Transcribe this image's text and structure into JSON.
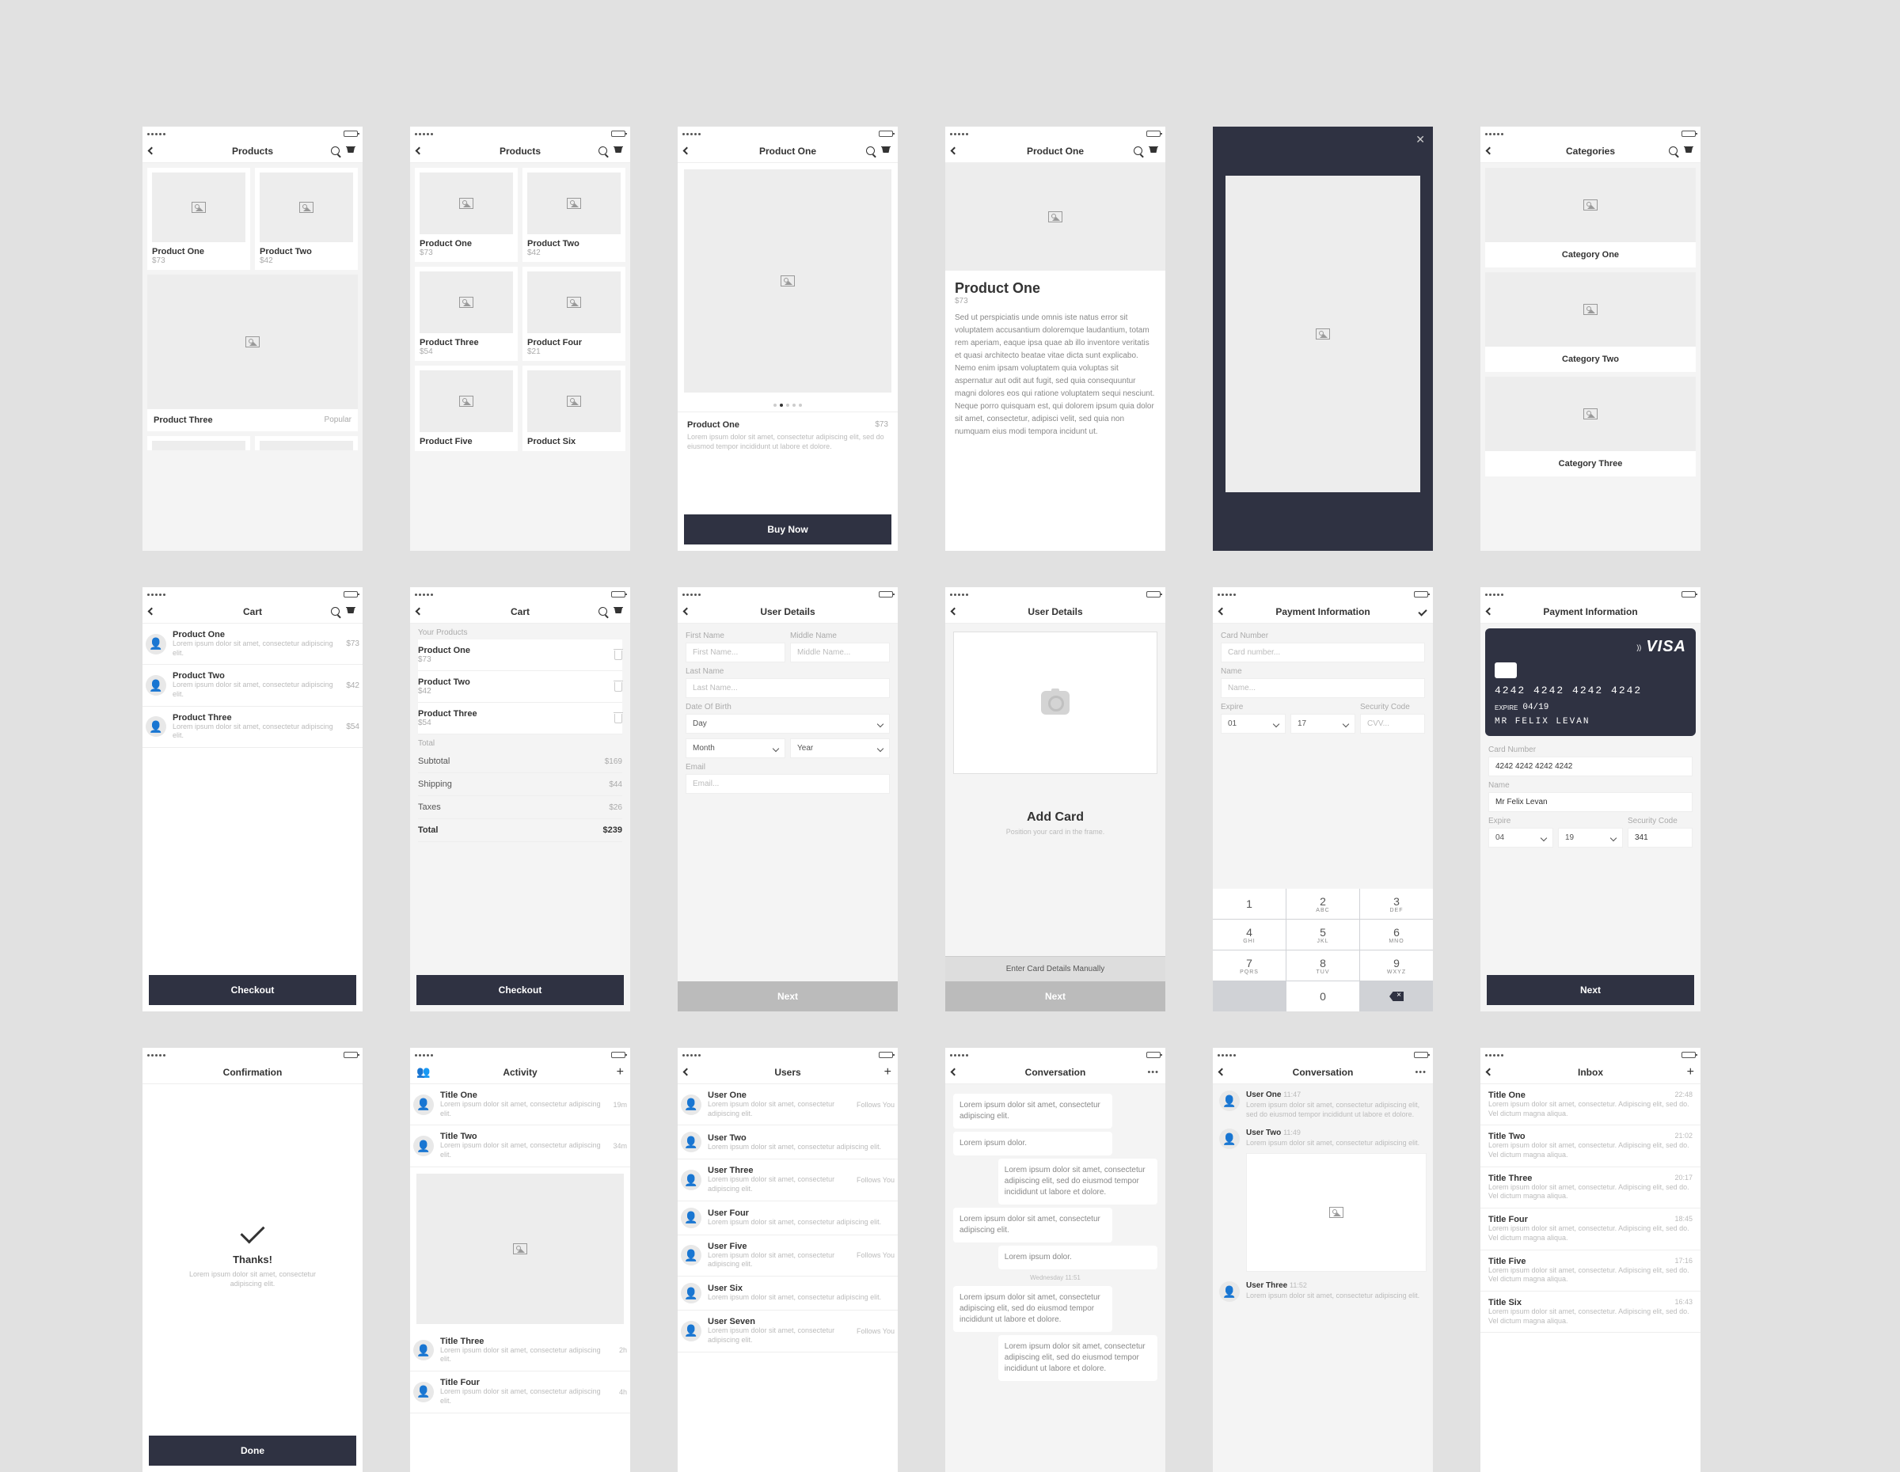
{
  "lorem_short": "Lorem ipsum dolor sit amet, consectetur adipiscing elit.",
  "lorem_med": "Lorem ipsum dolor sit amet, consectetur adipiscing elit, sed do eiusmod tempor incididunt ut labore et dolore.",
  "lorem_inbox": "Lorem ipsum dolor sit amet, consectetur. Adipiscing elit, sed do. Vel dictum magna aliqua.",
  "s1": {
    "title": "Products",
    "p1": {
      "name": "Product One",
      "price": "$73"
    },
    "p2": {
      "name": "Product Two",
      "price": "$42"
    },
    "p3": {
      "name": "Product Three"
    },
    "popular": "Popular"
  },
  "s2": {
    "title": "Products",
    "p1": {
      "name": "Product One",
      "price": "$73"
    },
    "p2": {
      "name": "Product Two",
      "price": "$42"
    },
    "p3": {
      "name": "Product Three",
      "price": "$54"
    },
    "p4": {
      "name": "Product Four",
      "price": "$21"
    },
    "p5": {
      "name": "Product Five"
    },
    "p6": {
      "name": "Product Six"
    }
  },
  "s3": {
    "title": "Product One",
    "name": "Product One",
    "price": "$73",
    "buy": "Buy Now"
  },
  "s4": {
    "title": "Product One",
    "name": "Product One",
    "price": "$73",
    "desc": "Sed ut perspiciatis unde omnis iste natus error sit voluptatem accusantium doloremque laudantium, totam rem aperiam, eaque ipsa quae ab illo inventore veritatis et quasi architecto beatae vitae dicta sunt explicabo. Nemo enim ipsam voluptatem quia voluptas sit aspernatur aut odit aut fugit, sed quia consequuntur magni dolores eos qui ratione voluptatem sequi nesciunt. Neque porro quisquam est, qui dolorem ipsum quia dolor sit amet, consectetur, adipisci velit, sed quia non numquam eius modi tempora incidunt ut."
  },
  "s6": {
    "title": "Categories",
    "c1": "Category One",
    "c2": "Category Two",
    "c3": "Category Three"
  },
  "s7": {
    "title": "Cart",
    "items": [
      {
        "name": "Product One",
        "price": "$73"
      },
      {
        "name": "Product Two",
        "price": "$42"
      },
      {
        "name": "Product Three",
        "price": "$54"
      }
    ],
    "checkout": "Checkout"
  },
  "s8": {
    "title": "Cart",
    "your": "Your Products",
    "items": [
      {
        "name": "Product One",
        "price": "$73"
      },
      {
        "name": "Product Two",
        "price": "$42"
      },
      {
        "name": "Product Three",
        "price": "$54"
      }
    ],
    "total_lbl": "Total",
    "subtotal": {
      "label": "Subtotal",
      "value": "$169"
    },
    "shipping": {
      "label": "Shipping",
      "value": "$44"
    },
    "taxes": {
      "label": "Taxes",
      "value": "$26"
    },
    "total": {
      "label": "Total",
      "value": "$239"
    },
    "checkout": "Checkout"
  },
  "s9": {
    "title": "User Details",
    "fn_lbl": "First Name",
    "mn_lbl": "Middle Name",
    "fn_ph": "First Name...",
    "mn_ph": "Middle Name...",
    "ln_lbl": "Last Name",
    "ln_ph": "Last Name...",
    "dob_lbl": "Date Of Birth",
    "day": "Day",
    "month": "Month",
    "year": "Year",
    "email_lbl": "Email",
    "email_ph": "Email...",
    "next": "Next"
  },
  "s10": {
    "title": "User Details",
    "h": "Add Card",
    "sub": "Position your card in the frame.",
    "manual": "Enter Card Details Manually",
    "next": "Next"
  },
  "s11": {
    "title": "Payment Information",
    "cn_lbl": "Card Number",
    "cn_ph": "Card number...",
    "name_lbl": "Name",
    "name_ph": "Name...",
    "exp_lbl": "Expire",
    "sec_lbl": "Security Code",
    "exp_m": "01",
    "exp_y": "17",
    "cvv_ph": "CVV...",
    "keys": [
      {
        "n": "1",
        "s": ""
      },
      {
        "n": "2",
        "s": "ABC"
      },
      {
        "n": "3",
        "s": "DEF"
      },
      {
        "n": "4",
        "s": "GHI"
      },
      {
        "n": "5",
        "s": "JKL"
      },
      {
        "n": "6",
        "s": "MNO"
      },
      {
        "n": "7",
        "s": "PQRS"
      },
      {
        "n": "8",
        "s": "TUV"
      },
      {
        "n": "9",
        "s": "WXYZ"
      },
      {
        "n": "",
        "s": ""
      },
      {
        "n": "0",
        "s": ""
      },
      {
        "n": "",
        "s": ""
      }
    ]
  },
  "s12": {
    "title": "Payment Information",
    "brand": "VISA",
    "ccnum": "4242  4242  4242  4242",
    "exp_lbl_card": "EXPIRE",
    "exp_card": "04/19",
    "name_card": "MR FELIX LEVAN",
    "cn_lbl": "Card Number",
    "cn_val": "4242 4242 4242 4242",
    "name_lbl": "Name",
    "name_val": "Mr Felix Levan",
    "exp_lbl": "Expire",
    "sec_lbl": "Security Code",
    "exp_m": "04",
    "exp_y": "19",
    "cvv": "341",
    "next": "Next"
  },
  "s13": {
    "title": "Confirmation",
    "h": "Thanks!",
    "done": "Done"
  },
  "s14": {
    "title": "Activity",
    "items": [
      {
        "t": "Title One",
        "m": "19m"
      },
      {
        "t": "Title Two",
        "m": "34m"
      },
      {
        "t": "Title Three",
        "m": "2h"
      },
      {
        "t": "Title Four",
        "m": "4h"
      }
    ]
  },
  "s15": {
    "title": "Users",
    "follows": "Follows You",
    "items": [
      "User One",
      "User Two",
      "User Three",
      "User Four",
      "User Five",
      "User Six",
      "User Seven"
    ]
  },
  "s16": {
    "title": "Conversation",
    "ts1": "Wednesday 11:51",
    "m_short": "Lorem ipsum dolor."
  },
  "s17": {
    "title": "Conversation",
    "u1": {
      "name": "User One",
      "time": "11:47"
    },
    "u2": {
      "name": "User Two",
      "time": "11:49"
    },
    "u3": {
      "name": "User Three",
      "time": "11:52"
    }
  },
  "s18": {
    "title": "Inbox",
    "items": [
      {
        "t": "Title One",
        "m": "22:48"
      },
      {
        "t": "Title Two",
        "m": "21:02"
      },
      {
        "t": "Title Three",
        "m": "20:17"
      },
      {
        "t": "Title Four",
        "m": "18:45"
      },
      {
        "t": "Title Five",
        "m": "17:16"
      },
      {
        "t": "Title Six",
        "m": "16:43"
      }
    ]
  }
}
